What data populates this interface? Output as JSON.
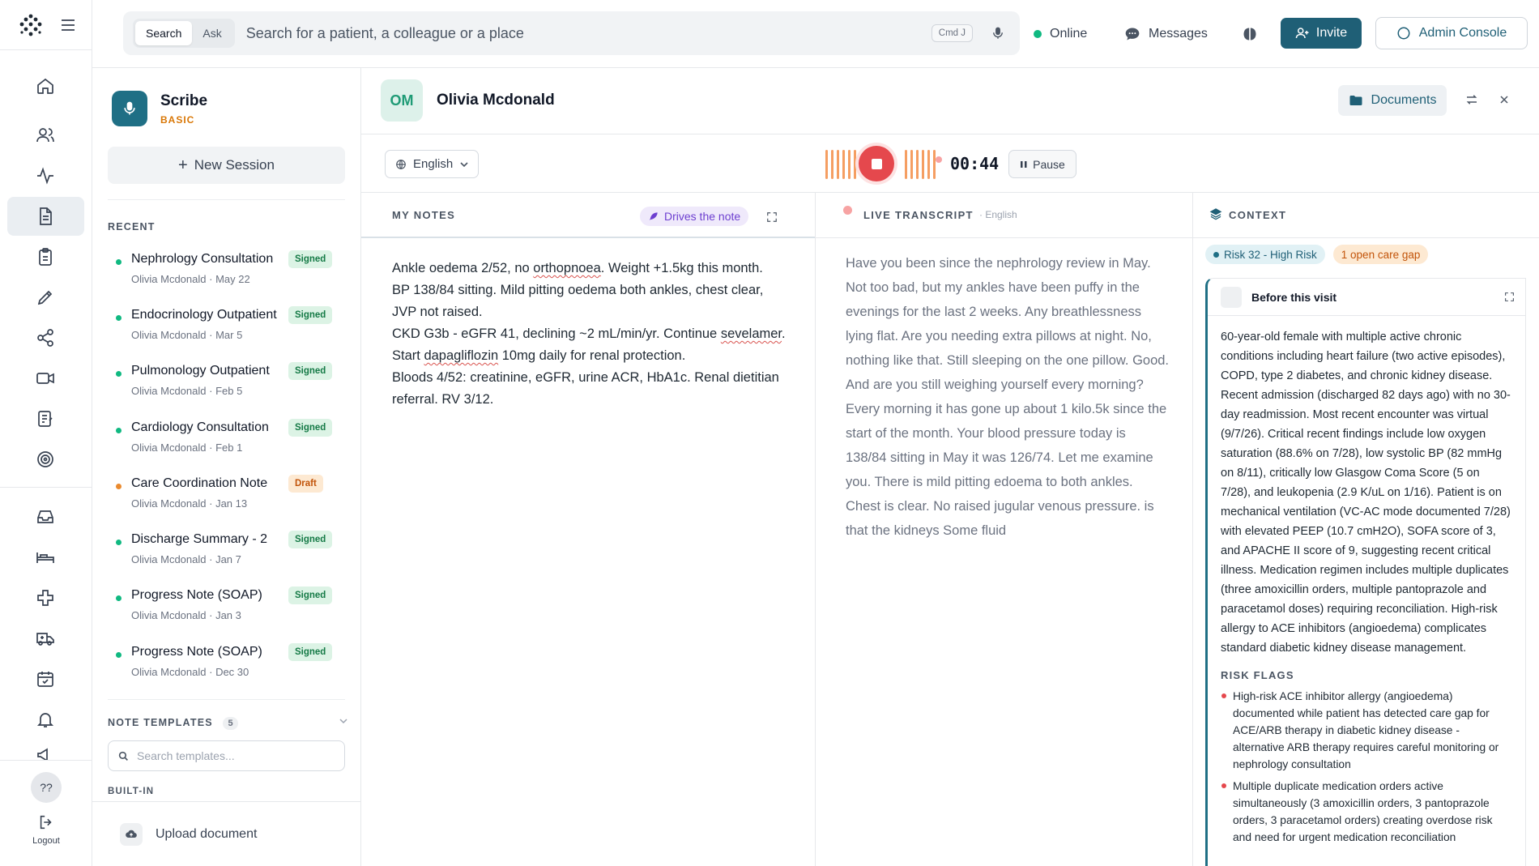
{
  "rail": {
    "items": [
      "home-icon",
      "users-icon",
      "activity-icon",
      "document-icon",
      "clipboard-icon",
      "pen-icon",
      "share-icon",
      "video-icon",
      "checklist-icon",
      "target-icon",
      "inbox-icon",
      "bed-icon",
      "plus-cross-icon",
      "ambulance-icon",
      "calendar-icon",
      "bell-icon",
      "megaphone-icon"
    ],
    "help_label": "??",
    "logout_label": "Logout"
  },
  "topbar": {
    "mode_search": "Search",
    "mode_ask": "Ask",
    "search_placeholder": "Search for a patient, a colleague or a place",
    "shortcut": "Cmd J",
    "status": "Online",
    "messages": "Messages",
    "invite": "Invite",
    "admin": "Admin Console"
  },
  "scribe": {
    "title": "Scribe",
    "plan": "BASIC",
    "new_session": "New Session",
    "recent_label": "RECENT",
    "recent": [
      {
        "title": "Nephrology Consultation",
        "patient": "Olivia Mcdonald",
        "date": "May 22",
        "status": "Signed"
      },
      {
        "title": "Endocrinology Outpatient",
        "patient": "Olivia Mcdonald",
        "date": "Mar 5",
        "status": "Signed"
      },
      {
        "title": "Pulmonology Outpatient",
        "patient": "Olivia Mcdonald",
        "date": "Feb 5",
        "status": "Signed"
      },
      {
        "title": "Cardiology Consultation",
        "patient": "Olivia Mcdonald",
        "date": "Feb 1",
        "status": "Signed"
      },
      {
        "title": "Care Coordination Note",
        "patient": "Olivia Mcdonald",
        "date": "Jan 13",
        "status": "Draft"
      },
      {
        "title": "Discharge Summary - 2",
        "patient": "Olivia Mcdonald",
        "date": "Jan 7",
        "status": "Signed"
      },
      {
        "title": "Progress Note (SOAP)",
        "patient": "Olivia Mcdonald",
        "date": "Jan 3",
        "status": "Signed"
      },
      {
        "title": "Progress Note (SOAP)",
        "patient": "Olivia Mcdonald",
        "date": "Dec 30",
        "status": "Signed"
      }
    ],
    "templates_label": "NOTE TEMPLATES",
    "templates_count": "5",
    "templates_search_placeholder": "Search templates...",
    "built_in_label": "BUILT-IN",
    "upload": "Upload document"
  },
  "patient": {
    "initials": "OM",
    "name": "Olivia Mcdonald",
    "documents": "Documents"
  },
  "recorder": {
    "language": "English",
    "timer": "00:44",
    "pause": "Pause"
  },
  "notes": {
    "label": "MY NOTES",
    "drives": "Drives the note",
    "lines": [
      "Ankle oedema 2/52, no orthopnoea. Weight +1.5kg this month.",
      "BP 138/84 sitting. Mild pitting oedema both ankles, chest clear, JVP not raised.",
      "CKD G3b - eGFR 41, declining ~2 mL/min/yr. Continue sevelamer.",
      "Start dapagliflozin 10mg daily for renal protection.",
      "Bloods 4/52: creatinine, eGFR, urine ACR, HbA1c. Renal dietitian referral. RV 3/12."
    ]
  },
  "transcript": {
    "label": "LIVE TRANSCRIPT",
    "language": "· English",
    "text": "Have you been since the nephrology review in May. Not too bad, but my ankles have been puffy in the evenings for the last 2 weeks. Any breathlessness lying flat. Are you needing extra pillows at night. No, nothing like that. Still sleeping on the one pillow. Good. And are you still weighing yourself every morning? Every morning it has gone up about 1 kilo.5k since the start of the month. Your blood pressure today is 138/84 sitting in May it was 126/74. Let me examine you. There is mild pitting edoema to both ankles. Chest is clear. No raised jugular venous pressure. is that the kidneys Some fluid"
  },
  "context": {
    "label": "CONTEXT",
    "risk_tag": "Risk 32 - High Risk",
    "gap_tag": "1 open care gap",
    "card_title": "Before this visit",
    "summary": "60-year-old female with multiple active chronic conditions including heart failure (two active episodes), COPD, type 2 diabetes, and chronic kidney disease. Recent admission (discharged 82 days ago) with no 30-day readmission. Most recent encounter was virtual (9/7/26). Critical recent findings include low oxygen saturation (88.6% on 7/28), low systolic BP (82 mmHg on 8/11), critically low Glasgow Coma Score (5 on 7/28), and leukopenia (2.9 K/uL on 1/16). Patient is on mechanical ventilation (VC-AC mode documented 7/28) with elevated PEEP (10.7 cmH2O), SOFA score of 3, and APACHE II score of 9, suggesting recent critical illness. Medication regimen includes multiple duplicates (three amoxicillin orders, multiple pantoprazole and paracetamol doses) requiring reconciliation. High-risk allergy to ACE inhibitors (angioedema) complicates standard diabetic kidney disease management.",
    "flags_label": "RISK FLAGS",
    "flags": [
      "High-risk ACE inhibitor allergy (angioedema) documented while patient has detected care gap for ACE/ARB therapy in diabetic kidney disease - alternative ARB therapy requires careful monitoring or nephrology consultation",
      "Multiple duplicate medication orders active simultaneously (3 amoxicillin orders, 3 pantoprazole orders, 3 paracetamol orders) creating overdose risk and need for urgent medication reconciliation"
    ]
  },
  "colors": {
    "brand": "#1f5f76",
    "record": "#e5484d",
    "signed": "#157a46",
    "draft": "#c2540a"
  }
}
